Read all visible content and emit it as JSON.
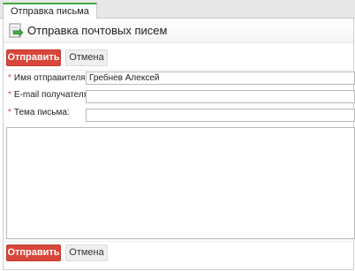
{
  "tab": {
    "label": "Отправка письма"
  },
  "header": {
    "title": "Отправка почтовых писем",
    "icon": "mail-send-icon"
  },
  "toolbar_top": {
    "send_label": "Отправить",
    "cancel_label": "Отмена"
  },
  "form": {
    "sender": {
      "label": "Имя отправителя:",
      "value": "Гребнев Алексей",
      "required": true
    },
    "recipient": {
      "label": "E-mail получателя:",
      "value": "",
      "required": true
    },
    "subject": {
      "label": "Тема письма:",
      "value": "",
      "required": true
    },
    "body": {
      "value": ""
    }
  },
  "toolbar_bottom": {
    "send_label": "Отправить",
    "cancel_label": "Отмена"
  },
  "colors": {
    "accent": "#d9463a",
    "tab_indicator": "#3fa83f"
  }
}
